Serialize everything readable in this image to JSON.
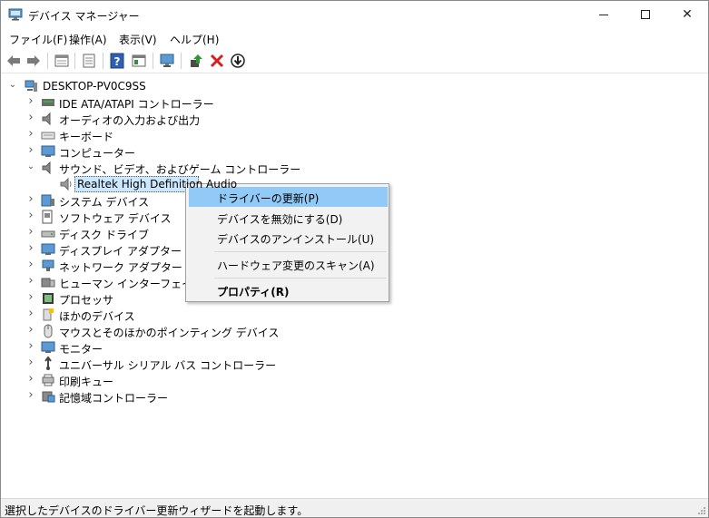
{
  "window": {
    "title": "デバイス マネージャー",
    "controls": {
      "minimize": "–",
      "maximize": "□",
      "close": "✕"
    }
  },
  "menu": [
    "ファイル(F)",
    "操作(A)",
    "表示(V)",
    "ヘルプ(H)"
  ],
  "toolbar": [
    "back-icon",
    "forward-icon",
    "properties-sheet-icon",
    "device-list-icon",
    "help-icon",
    "view-icon",
    "monitor-icon",
    "update-driver-icon",
    "uninstall-icon",
    "disable-icon"
  ],
  "tree": {
    "root": "DESKTOP-PV0C9SS",
    "items": [
      {
        "label": "IDE ATA/ATAPI コントローラー",
        "expanded": false
      },
      {
        "label": "オーディオの入力および出力",
        "expanded": false
      },
      {
        "label": "キーボード",
        "expanded": false
      },
      {
        "label": "コンピューター",
        "expanded": false
      },
      {
        "label": "サウンド、ビデオ、およびゲーム コントローラー",
        "expanded": true
      },
      {
        "label": "Realtek High Definition Audio",
        "child": true,
        "selected": true
      },
      {
        "label": "システム デバイス",
        "expanded": false
      },
      {
        "label": "ソフトウェア デバイス",
        "expanded": false
      },
      {
        "label": "ディスク ドライブ",
        "expanded": false
      },
      {
        "label": "ディスプレイ アダプター",
        "expanded": false
      },
      {
        "label": "ネットワーク アダプター",
        "expanded": false
      },
      {
        "label": "ヒューマン インターフェイス デバイス",
        "expanded": false
      },
      {
        "label": "プロセッサ",
        "expanded": false
      },
      {
        "label": "ほかのデバイス",
        "expanded": false
      },
      {
        "label": "マウスとそのほかのポインティング デバイス",
        "expanded": false
      },
      {
        "label": "モニター",
        "expanded": false
      },
      {
        "label": "ユニバーサル シリアル バス コントローラー",
        "expanded": false
      },
      {
        "label": "印刷キュー",
        "expanded": false
      },
      {
        "label": "記憶域コントローラー",
        "expanded": false
      }
    ]
  },
  "context_menu": {
    "update_driver": "ドライバーの更新(P)",
    "disable_device": "デバイスを無効にする(D)",
    "uninstall_device": "デバイスのアンインストール(U)",
    "scan_hardware": "ハードウェア変更のスキャン(A)",
    "properties": "プロパティ(R)"
  },
  "status": "選択したデバイスのドライバー更新ウィザードを起動します。"
}
